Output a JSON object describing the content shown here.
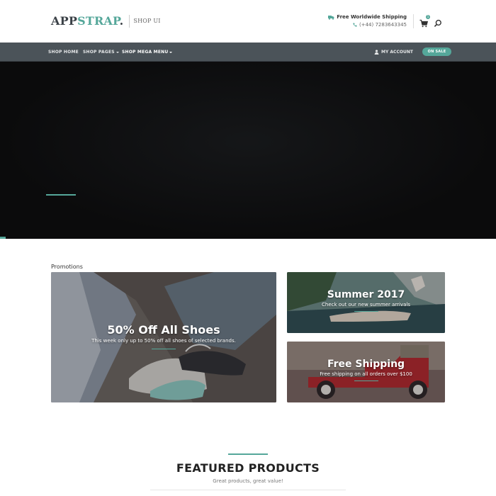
{
  "brand": {
    "logo_main": "APP",
    "logo_accent": "STRAP",
    "logo_dot": ".",
    "logo_sub": "SHOP UI"
  },
  "header": {
    "shipping_label": "Free Worldwide Shipping",
    "phone": "(+44) 7283643345",
    "cart_count": "1"
  },
  "nav": {
    "items": [
      {
        "label": "SHOP HOME"
      },
      {
        "label": "SHOP PAGES"
      },
      {
        "label": "SHOP MEGA MENU"
      }
    ],
    "account_label": "MY ACCOUNT",
    "sale_label": "ON SALE"
  },
  "promotions": {
    "label": "Promotions",
    "cards": [
      {
        "title": "50% Off All Shoes",
        "subtitle": "This week only up to 50% off all shoes of selected brands."
      },
      {
        "title": "Summer 2017",
        "subtitle": "Check out our new summer arrivals"
      },
      {
        "title": "Free Shipping",
        "subtitle": "Free shipping on all orders over $100"
      }
    ]
  },
  "featured": {
    "title": "FEATURED PRODUCTS",
    "subtitle": "Great products, great value!"
  },
  "colors": {
    "accent": "#55a79a",
    "navbar": "#4b5359",
    "hero": "#0b0b0c"
  }
}
